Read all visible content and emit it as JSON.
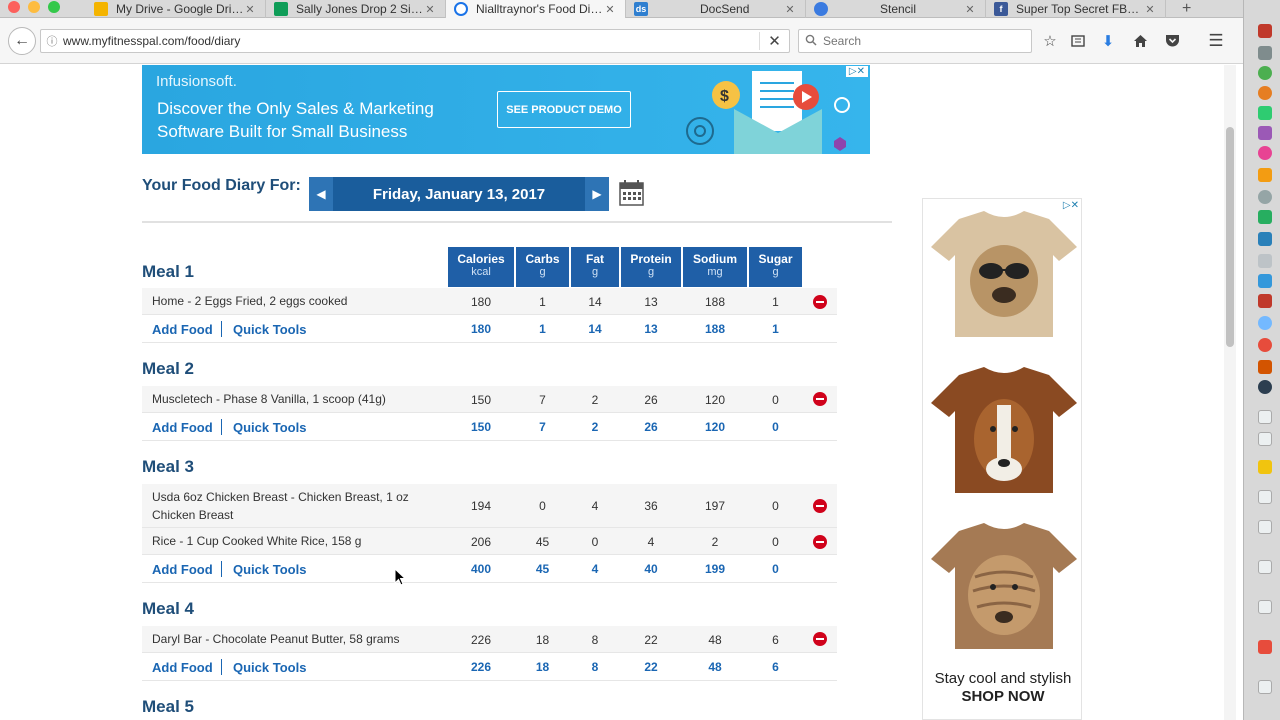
{
  "browser": {
    "tabs": [
      {
        "title": "My Drive - Google Dri…",
        "favicon": "google-drive-icon",
        "color": "#f4b400",
        "active": false
      },
      {
        "title": "Sally Jones Drop 2 Si…",
        "favicon": "google-sheets-icon",
        "color": "#0f9d58",
        "active": false
      },
      {
        "title": "Nialltraynor's Food Di…",
        "favicon": "loading-spinner-icon",
        "color": "#1a73e8",
        "active": true
      },
      {
        "title": "DocSend",
        "favicon": "docsend-icon",
        "color": "#2f7fd0",
        "active": false
      },
      {
        "title": "Stencil",
        "favicon": "stencil-icon",
        "color": "#3b7be0",
        "active": false
      },
      {
        "title": "Super Top Secret FB…",
        "favicon": "facebook-icon",
        "color": "#3b5998",
        "active": false
      }
    ],
    "url": "www.myfitnesspal.com/food/diary",
    "search_placeholder": "Search"
  },
  "banner_ad": {
    "brand": "Infusionsoft.",
    "headline": "Discover the Only Sales & Marketing Software Built for Small Business",
    "cta": "SEE PRODUCT DEMO"
  },
  "diary": {
    "header": "Your Food Diary For:",
    "date": "Friday, January 13, 2017",
    "columns": [
      {
        "name": "Calories",
        "unit": "kcal"
      },
      {
        "name": "Carbs",
        "unit": "g"
      },
      {
        "name": "Fat",
        "unit": "g"
      },
      {
        "name": "Protein",
        "unit": "g"
      },
      {
        "name": "Sodium",
        "unit": "mg"
      },
      {
        "name": "Sugar",
        "unit": "g"
      }
    ],
    "add_food_label": "Add Food",
    "quick_tools_label": "Quick Tools",
    "meals": [
      {
        "title": "Meal 1",
        "foods": [
          {
            "name": "Home - 2 Eggs Fried, 2 eggs cooked",
            "values": [
              "180",
              "1",
              "14",
              "13",
              "188",
              "1"
            ]
          }
        ],
        "totals": [
          "180",
          "1",
          "14",
          "13",
          "188",
          "1"
        ]
      },
      {
        "title": "Meal 2",
        "foods": [
          {
            "name": "Muscletech - Phase 8 Vanilla, 1 scoop (41g)",
            "values": [
              "150",
              "7",
              "2",
              "26",
              "120",
              "0"
            ]
          }
        ],
        "totals": [
          "150",
          "7",
          "2",
          "26",
          "120",
          "0"
        ]
      },
      {
        "title": "Meal 3",
        "foods": [
          {
            "name_line1": "Usda 6oz Chicken Breast - Chicken Breast, 1 oz",
            "name_line2": "Chicken Breast",
            "values": [
              "194",
              "0",
              "4",
              "36",
              "197",
              "0"
            ]
          },
          {
            "name": "Rice - 1 Cup Cooked White Rice, 158 g",
            "values": [
              "206",
              "45",
              "0",
              "4",
              "2",
              "0"
            ]
          }
        ],
        "totals": [
          "400",
          "45",
          "4",
          "40",
          "199",
          "0"
        ]
      },
      {
        "title": "Meal 4",
        "foods": [
          {
            "name": "Daryl Bar - Chocolate Peanut Butter, 58 grams",
            "values": [
              "226",
              "18",
              "8",
              "22",
              "48",
              "6"
            ]
          }
        ],
        "totals": [
          "226",
          "18",
          "8",
          "22",
          "48",
          "6"
        ]
      },
      {
        "title": "Meal 5"
      }
    ]
  },
  "side_ad": {
    "tagline": "Stay cool and stylish",
    "cta": "SHOP NOW"
  },
  "colors": {
    "brand_blue": "#1f4e79",
    "header_blue": "#1f5fa7",
    "link_blue": "#1a66b3",
    "delete_red": "#d0021b"
  }
}
